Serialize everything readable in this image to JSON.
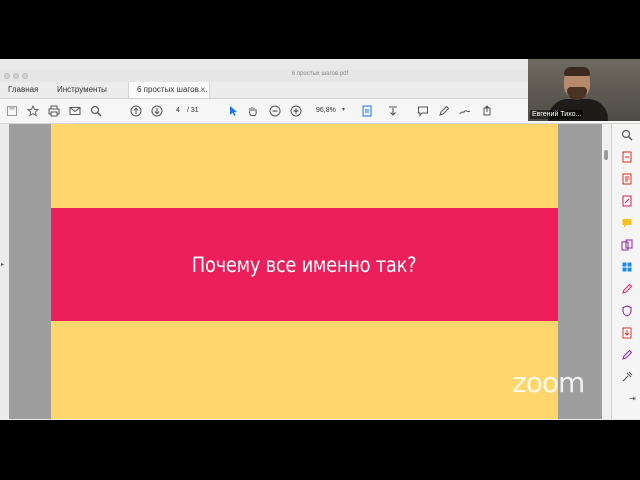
{
  "window": {
    "doc_title": "6 простых шагов.pdf"
  },
  "tabs": {
    "home": "Главная",
    "tools": "Инструменты",
    "doc": "6 простых шагов....",
    "close": "×"
  },
  "toolbar": {
    "page_current": "4",
    "page_total": "/ 31",
    "zoom": "96,8%"
  },
  "slide": {
    "heading": "Почему все именно так?",
    "background_color": "#ffd66b",
    "band_color": "#ec1f5a"
  },
  "participant": {
    "name": "Евгений Тихо..."
  },
  "watermark": {
    "text": "zoom"
  }
}
